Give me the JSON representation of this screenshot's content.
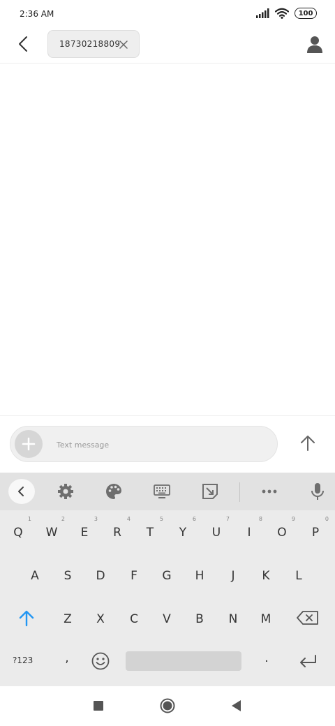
{
  "status_bar": {
    "time": "2:36 AM",
    "battery": "100",
    "icons": [
      "signal-icon",
      "wifi-icon",
      "battery-icon"
    ]
  },
  "header": {
    "back_icon": "back-arrow-icon",
    "recipient": "18730218809",
    "remove_icon": "close-icon",
    "contact_icon": "person-icon"
  },
  "compose": {
    "placeholder": "Text message",
    "value": "",
    "attach_icon": "plus-icon",
    "send_icon": "arrow-up-icon"
  },
  "keyboard": {
    "toolbar_icons": [
      "chevron-left-icon",
      "gear-icon",
      "palette-icon",
      "keyboard-icon",
      "resize-icon",
      "more-icon",
      "microphone-icon"
    ],
    "row1": [
      {
        "key": "Q",
        "hint": "1"
      },
      {
        "key": "W",
        "hint": "2"
      },
      {
        "key": "E",
        "hint": "3"
      },
      {
        "key": "R",
        "hint": "4"
      },
      {
        "key": "T",
        "hint": "5"
      },
      {
        "key": "Y",
        "hint": "6"
      },
      {
        "key": "U",
        "hint": "7"
      },
      {
        "key": "I",
        "hint": "8"
      },
      {
        "key": "O",
        "hint": "9"
      },
      {
        "key": "P",
        "hint": "0"
      }
    ],
    "row2": [
      "A",
      "S",
      "D",
      "F",
      "G",
      "H",
      "J",
      "K",
      "L"
    ],
    "row3": [
      "Z",
      "X",
      "C",
      "V",
      "B",
      "N",
      "M"
    ],
    "symbols_label": "?123",
    "comma": ",",
    "period": ".",
    "accent_color": "#2196f3"
  },
  "nav_bar": {
    "icons": [
      "recent-apps-icon",
      "home-icon",
      "back-icon"
    ]
  }
}
